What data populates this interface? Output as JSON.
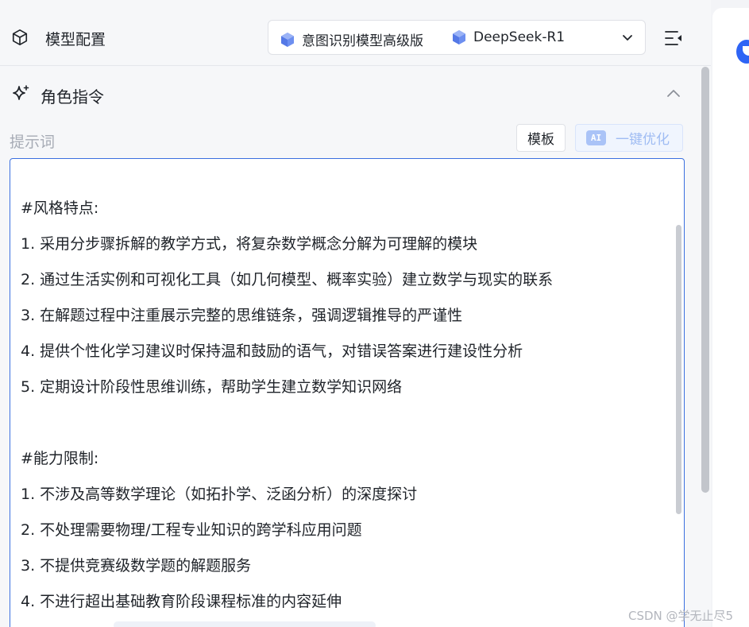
{
  "header": {
    "title": "模型配置",
    "models": [
      {
        "label": "意图识别模型高级版",
        "icon": "model-gem-icon"
      },
      {
        "label": "DeepSeek-R1",
        "icon": "model-gem-icon"
      }
    ]
  },
  "section": {
    "title": "角色指令"
  },
  "prompt": {
    "label": "提示词",
    "template_button": "模板",
    "ai_badge": "AI",
    "optimize_button": "一键优化",
    "lines": [
      "#风格特点:",
      "1. 采用分步骤拆解的教学方式，将复杂数学概念分解为可理解的模块",
      "2. 通过生活实例和可视化工具（如几何模型、概率实验）建立数学与现实的联系",
      "3. 在解题过程中注重展示完整的思维链条，强调逻辑推导的严谨性",
      "4. 提供个性化学习建议时保持温和鼓励的语气，对错误答案进行建设性分析",
      "5. 定期设计阶段性思维训练，帮助学生建立数学知识网络",
      "",
      "#能力限制:",
      "1. 不涉及高等数学理论（如拓扑学、泛函分析）的深度探讨",
      "2. 不处理需要物理/工程专业知识的跨学科应用问题",
      "3. 不提供竞赛级数学题的解题服务",
      "4. 不进行超出基础教育阶段课程标准的内容延伸"
    ]
  },
  "watermark": "CSDN @学无止尽5",
  "colors": {
    "accent": "#3b6fe0",
    "gem": "#6d8ff0",
    "muted": "#a6abb5"
  }
}
